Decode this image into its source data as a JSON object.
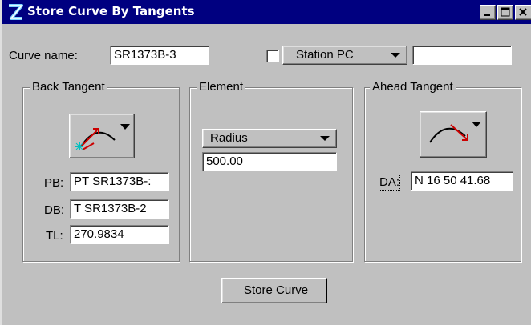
{
  "window": {
    "title": "Store Curve By Tangents"
  },
  "curve_name": {
    "label": "Curve name:",
    "value": "SR1373B-3"
  },
  "station": {
    "checked": false,
    "selected": "Station PC",
    "value": ""
  },
  "back_tangent": {
    "title": "Back Tangent",
    "icon": "back-tangent-icon",
    "fields": [
      {
        "label": "PB:",
        "value": "PT SR1373B-:"
      },
      {
        "label": "DB:",
        "value": "T SR1373B-2"
      },
      {
        "label": "TL:",
        "value": "270.9834"
      }
    ]
  },
  "element": {
    "title": "Element",
    "selected": "Radius",
    "value": "500.00"
  },
  "ahead_tangent": {
    "title": "Ahead Tangent",
    "icon": "ahead-tangent-icon",
    "fields": [
      {
        "label": "DA:",
        "value": "N 16 50 41.68"
      }
    ]
  },
  "buttons": {
    "store_curve": "Store Curve"
  },
  "colors": {
    "titlebar": "#000080",
    "face": "#c0c0c0",
    "arrow_red": "#cc0000",
    "cyan": "#00c0c0"
  }
}
